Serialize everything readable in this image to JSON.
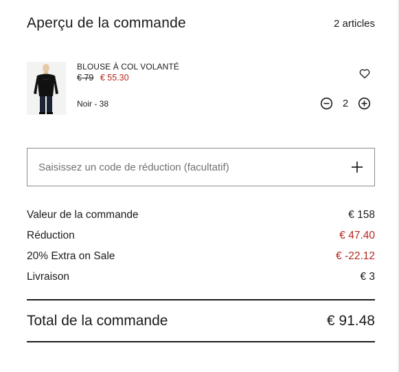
{
  "header": {
    "title": "Aperçu de la commande",
    "item_count": "2 articles"
  },
  "product": {
    "name": "BLOUSE À COL VOLANTÉ",
    "old_price": "€ 79",
    "new_price": "€ 55.30",
    "variant": "Noir - 38",
    "quantity": "2",
    "image_icon": "black-ruffle-blouse-photo",
    "favorite_icon": "heart-icon",
    "decrease_icon": "minus-circle-icon",
    "increase_icon": "plus-circle-icon"
  },
  "promo": {
    "placeholder": "Saisissez un code de réduction (facultatif)",
    "value": "",
    "add_icon": "plus-icon"
  },
  "summary": {
    "rows": [
      {
        "label": "Valeur de la commande",
        "value": "€ 158"
      },
      {
        "label": "Réduction",
        "value": "€ 47.40"
      },
      {
        "label": "20% Extra on Sale",
        "value": "€ -22.12"
      },
      {
        "label": "Livraison",
        "value": "€ 3"
      }
    ]
  },
  "total": {
    "label": "Total de la commande",
    "value": "€ 91.48"
  },
  "colors": {
    "accent_red": "#b3261e",
    "text": "#1a1a1a",
    "border": "#8a8a8a"
  }
}
